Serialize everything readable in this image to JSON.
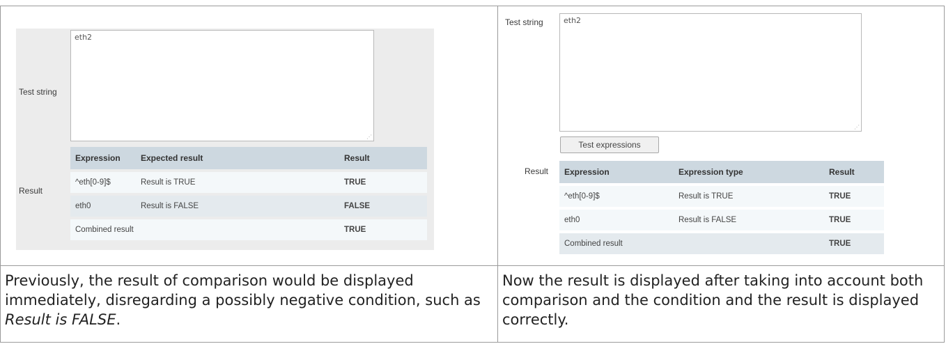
{
  "left": {
    "test_string_label": "Test string",
    "test_string_value": "eth2",
    "result_label": "Result",
    "headers": [
      "Expression",
      "Expected result",
      "Result"
    ],
    "rows": [
      {
        "expression": "^eth[0-9]$",
        "condition": "Result is TRUE",
        "result": "TRUE",
        "result_color": "#2fa11f"
      },
      {
        "expression": "eth0",
        "condition": "Result is FALSE",
        "result": "FALSE",
        "result_color": "#d91e1e"
      }
    ],
    "combined_label": "Combined result",
    "combined_result": "TRUE"
  },
  "right": {
    "test_string_label": "Test string",
    "test_string_value": "eth2",
    "button_label": "Test expressions",
    "result_label": "Result",
    "headers": [
      "Expression",
      "Expression type",
      "Result"
    ],
    "rows": [
      {
        "expression": "^eth[0-9]$",
        "condition": "Result is TRUE",
        "result": "TRUE",
        "result_color": "#2fa11f"
      },
      {
        "expression": "eth0",
        "condition": "Result is FALSE",
        "result": "TRUE",
        "result_color": "#2fa11f"
      }
    ],
    "combined_label": "Combined result",
    "combined_result": "TRUE"
  },
  "captions": {
    "left_pre": "Previously, the result of comparison would be displayed immediately, disregarding a possibly negative condition, such as ",
    "left_em": "Result is FALSE",
    "left_post": ".",
    "right": "Now the result is displayed after taking into account both comparison and the condition and the result is displayed correctly."
  }
}
